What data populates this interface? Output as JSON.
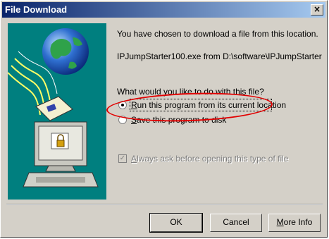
{
  "window": {
    "title": "File Download",
    "close_label": "×"
  },
  "message": {
    "intro": "You have chosen to download a file from this location.",
    "file": "IPJumpStarter100.exe from D:\\software\\IPJumpStarter",
    "question": "What would you like to do with this file?"
  },
  "options": [
    {
      "label_first": "R",
      "label_rest": "un this program from its current location",
      "selected": true
    },
    {
      "label_first": "S",
      "label_rest": "ave this program to disk",
      "selected": false
    }
  ],
  "checkbox": {
    "label_first": "A",
    "label_rest": "lways ask before opening this type of file",
    "checked": true,
    "enabled": false
  },
  "buttons": {
    "ok": "OK",
    "cancel": "Cancel",
    "more_first": "M",
    "more_rest": "ore Info"
  },
  "colors": {
    "title_start": "#0a246a",
    "title_end": "#a6caf0",
    "art_bg": "#007f7f",
    "highlight": "#e20000"
  }
}
